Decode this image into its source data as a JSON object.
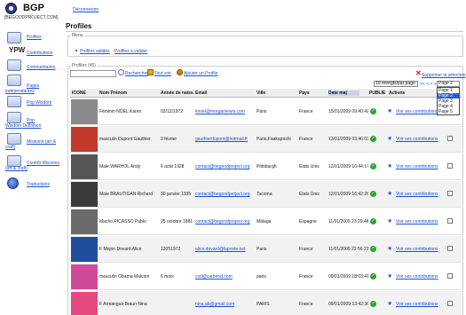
{
  "brand": {
    "name": "BGP",
    "subtitle": "[BEGOODPROJECT.COM]"
  },
  "header": {
    "logout": "Déconnexion",
    "title": "Profiles"
  },
  "sidebar": {
    "items": [
      {
        "label": "Profiles",
        "icon": "profiles-icon"
      },
      {
        "label": "Contributions",
        "icon": "ypw-logo-icon",
        "logo_text": "YPW"
      },
      {
        "label": "Commentaires",
        "icon": "comments-icon"
      },
      {
        "label": "Pages indépendantes",
        "icon": "pages-icon"
      },
      {
        "label": "Pop Wisdom",
        "icon": "popwisdom-icon"
      },
      {
        "label": "Pop Wisdom Definition",
        "icon": "popwisdom-definition-icon"
      },
      {
        "label": "Missions (art & craft)",
        "icon": "missions-icon"
      },
      {
        "label": "Contrib Missions (art & craft)",
        "icon": "contrib-missions-icon"
      },
      {
        "label": "Traductions",
        "icon": "globe-icon"
      }
    ]
  },
  "menu": {
    "legend": "Menu",
    "items": [
      "Profiles validés",
      "Profiles à valider"
    ]
  },
  "profiles": {
    "legend": "Profiles (45)",
    "search_value": "",
    "search_label": "Rechercher",
    "all_label": "Tout voir",
    "add_label": "Ajouter un Profile",
    "delete_label": "Supprimer la sélection",
    "per_page": "10 enregts/par page",
    "pager_arrows": "<< <  > >>",
    "page_selected": "Page 2",
    "page_options": [
      "Page 1",
      "Page 2",
      "Page 3",
      "Page 4",
      "Page 5"
    ],
    "page_highlighted": "Page 2"
  },
  "table": {
    "headers": [
      "ICONE",
      "Nom Prénom",
      "Année de naiss.",
      "Email",
      "Ville",
      "Pays",
      "Date maj",
      "PUBLIE",
      "Actions"
    ],
    "contrib_label": "Voir ses contributions",
    "rows": [
      {
        "name": "Féminin NOEL Karen",
        "year": "02/12/1972",
        "email": "knoel@morganlewis.com",
        "city": "Paris",
        "country": "France",
        "date": "15/01/2009 09:40:42",
        "thumb": "#8a8a8a"
      },
      {
        "name": "masculin Dupont Gauthier",
        "year": "3 février",
        "email": "gauthierdupont@hotmail.fr",
        "city": "Paris,Faakaposhi",
        "country": "France",
        "date": "13/01/2009 03:46:03",
        "thumb": "#c0392b"
      },
      {
        "name": "Male WARHOL Andy",
        "year": "6 août 1928",
        "email": "contact@begoodproject.org",
        "city": "Pittsburgh",
        "country": "Etats Unis",
        "date": "12/01/2009 16:44:17",
        "thumb": "#555555"
      },
      {
        "name": "Male BRAUTIGAN Richard",
        "year": "30 janvier 1935",
        "email": "contact@begoodproject.org",
        "city": "Tacoma",
        "country": "Etats Unis",
        "date": "12/01/2009 16:42:26",
        "thumb": "#3a3a3a"
      },
      {
        "name": "Macho PICASSO Pablo",
        "year": "25 octobre 1881",
        "email": "contact@begoodproject.org",
        "city": "Málaga",
        "country": "Espagne",
        "date": "11/01/2009 23:29:48",
        "thumb": "#6b6b6b"
      },
      {
        "name": "F Mojon Dovard Alice",
        "year": "12051972",
        "email": "alice.dovard@laposte.net",
        "city": "Paris",
        "country": "France",
        "date": "11/01/2009 22:56:23",
        "thumb": "#1f4f9a"
      },
      {
        "name": "masculin Obama Malcom",
        "year": "6 mois",
        "email": "csd@carbend.com",
        "city": "paris",
        "country": "France",
        "date": "09/01/2009 18:03:41",
        "thumb": "#d04a9a"
      },
      {
        "name": "F Armangué Braun Nina",
        "year": "",
        "email": "nina.ab@gmail.com",
        "city": "PARIS",
        "country": "France",
        "date": "09/01/2009 13:42:36",
        "thumb": "#e64a80"
      }
    ]
  }
}
